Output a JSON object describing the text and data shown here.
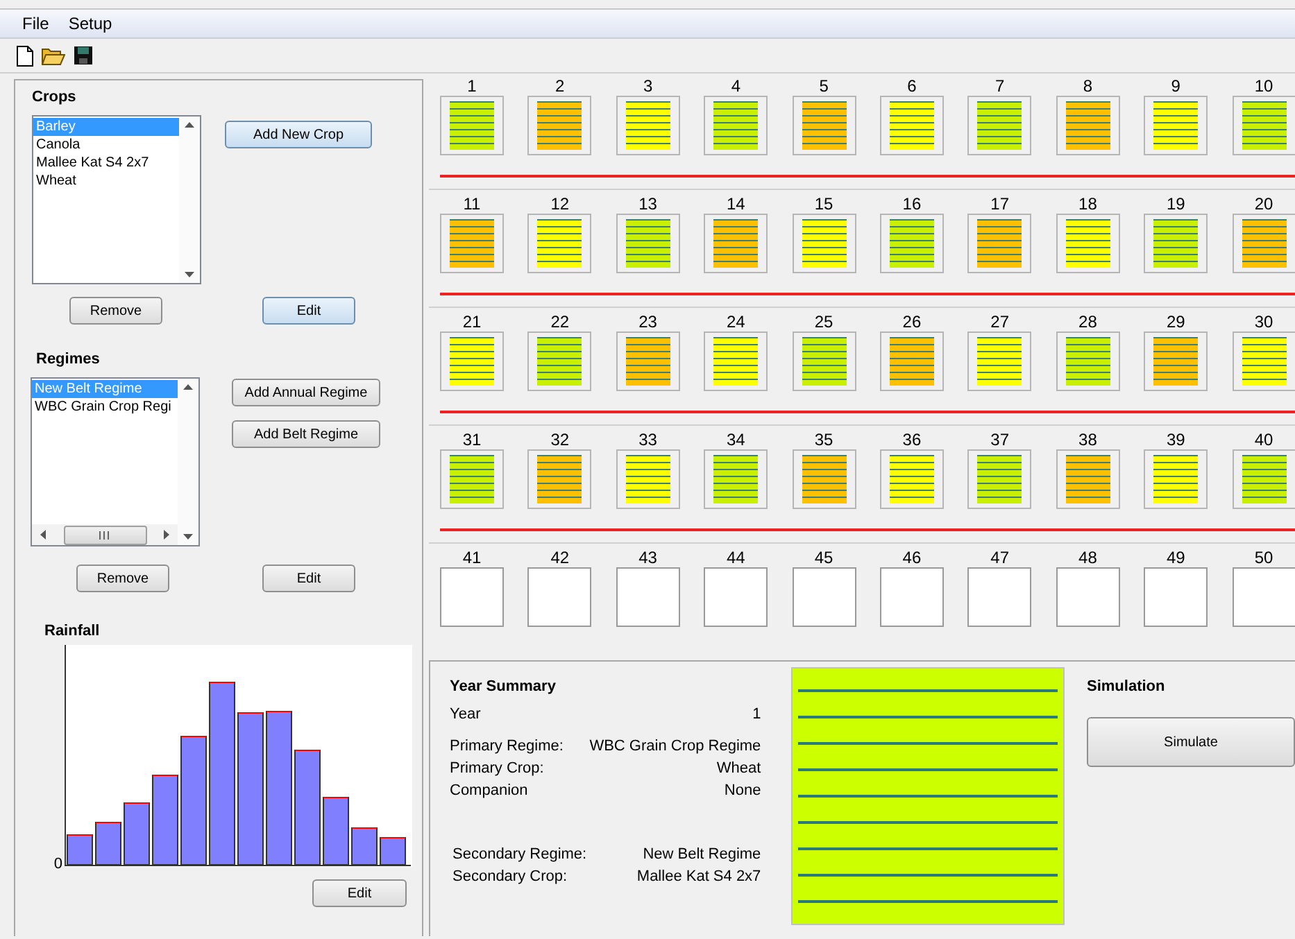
{
  "menu": [
    "File",
    "Setup"
  ],
  "crops": {
    "title": "Crops",
    "items": [
      {
        "label": "Barley",
        "selected": true
      },
      {
        "label": "Canola",
        "selected": false
      },
      {
        "label": "Mallee Kat S4 2x7",
        "selected": false
      },
      {
        "label": "Wheat",
        "selected": false
      }
    ],
    "add_button": "Add New Crop",
    "remove_button": "Remove",
    "edit_button": "Edit"
  },
  "regimes": {
    "title": "Regimes",
    "items": [
      {
        "label": "New Belt Regime",
        "selected": true
      },
      {
        "label": "WBC Grain Crop Regi",
        "selected": false
      }
    ],
    "add_buttons": [
      "Add Annual Regime",
      "Add Belt Regime"
    ],
    "remove_button": "Remove",
    "edit_button": "Edit"
  },
  "rainfall": {
    "title": "Rainfall",
    "axis_label": "0",
    "edit_button": "Edit"
  },
  "tiles": [
    {
      "number": "1",
      "kind": "planted",
      "color": "#c8f000"
    },
    {
      "number": "2",
      "kind": "planted",
      "color": "#ffc000"
    },
    {
      "number": "3",
      "kind": "planted",
      "color": "#ffff00"
    },
    {
      "number": "4",
      "kind": "planted",
      "color": "#c8f000"
    },
    {
      "number": "5",
      "kind": "planted",
      "color": "#ffc000"
    },
    {
      "number": "6",
      "kind": "planted",
      "color": "#ffff00"
    },
    {
      "number": "7",
      "kind": "planted",
      "color": "#c8f000"
    },
    {
      "number": "8",
      "kind": "planted",
      "color": "#ffc000"
    },
    {
      "number": "9",
      "kind": "planted",
      "color": "#ffff00"
    },
    {
      "number": "10",
      "kind": "planted",
      "color": "#c8f000"
    },
    {
      "number": "11",
      "kind": "planted",
      "color": "#ffc000"
    },
    {
      "number": "12",
      "kind": "planted",
      "color": "#ffff00"
    },
    {
      "number": "13",
      "kind": "planted",
      "color": "#c8f000"
    },
    {
      "number": "14",
      "kind": "planted",
      "color": "#ffc000"
    },
    {
      "number": "15",
      "kind": "planted",
      "color": "#ffff00"
    },
    {
      "number": "16",
      "kind": "planted",
      "color": "#c8f000"
    },
    {
      "number": "17",
      "kind": "planted",
      "color": "#ffc000"
    },
    {
      "number": "18",
      "kind": "planted",
      "color": "#ffff00"
    },
    {
      "number": "19",
      "kind": "planted",
      "color": "#c8f000"
    },
    {
      "number": "20",
      "kind": "planted",
      "color": "#ffc000"
    },
    {
      "number": "21",
      "kind": "planted",
      "color": "#ffff00"
    },
    {
      "number": "22",
      "kind": "planted",
      "color": "#c8f000"
    },
    {
      "number": "23",
      "kind": "planted",
      "color": "#ffc000"
    },
    {
      "number": "24",
      "kind": "planted",
      "color": "#ffff00"
    },
    {
      "number": "25",
      "kind": "planted",
      "color": "#c8f000"
    },
    {
      "number": "26",
      "kind": "planted",
      "color": "#ffc000"
    },
    {
      "number": "27",
      "kind": "planted",
      "color": "#ffff00"
    },
    {
      "number": "28",
      "kind": "planted",
      "color": "#c8f000"
    },
    {
      "number": "29",
      "kind": "planted",
      "color": "#ffc000"
    },
    {
      "number": "30",
      "kind": "planted",
      "color": "#ffff00"
    },
    {
      "number": "31",
      "kind": "planted",
      "color": "#c8f000"
    },
    {
      "number": "32",
      "kind": "planted",
      "color": "#ffc000"
    },
    {
      "number": "33",
      "kind": "planted",
      "color": "#ffff00"
    },
    {
      "number": "34",
      "kind": "planted",
      "color": "#c8f000"
    },
    {
      "number": "35",
      "kind": "planted",
      "color": "#ffc000"
    },
    {
      "number": "36",
      "kind": "planted",
      "color": "#ffff00"
    },
    {
      "number": "37",
      "kind": "planted",
      "color": "#c8f000"
    },
    {
      "number": "38",
      "kind": "planted",
      "color": "#ffc000"
    },
    {
      "number": "39",
      "kind": "planted",
      "color": "#ffff00"
    },
    {
      "number": "40",
      "kind": "planted",
      "color": "#c8f000"
    },
    {
      "number": "41",
      "kind": "empty"
    },
    {
      "number": "42",
      "kind": "empty"
    },
    {
      "number": "43",
      "kind": "empty"
    },
    {
      "number": "44",
      "kind": "empty"
    },
    {
      "number": "45",
      "kind": "empty"
    },
    {
      "number": "46",
      "kind": "empty"
    },
    {
      "number": "47",
      "kind": "empty"
    },
    {
      "number": "48",
      "kind": "empty"
    },
    {
      "number": "49",
      "kind": "empty"
    },
    {
      "number": "50",
      "kind": "empty"
    }
  ],
  "year_summary": {
    "title": "Year Summary",
    "primary": [
      {
        "label": "Year",
        "value": "1"
      },
      {
        "label": "Primary Regime:",
        "value": "WBC Grain Crop Regime"
      },
      {
        "label": "Primary Crop:",
        "value": "Wheat"
      },
      {
        "label": "Companion",
        "value": "None"
      }
    ],
    "secondary": [
      {
        "label": "Secondary Regime:",
        "value": "New Belt Regime"
      },
      {
        "label": "Secondary Crop:",
        "value": "Mallee Kat S4 2x7"
      }
    ]
  },
  "simulation": {
    "title": "Simulation",
    "button": "Simulate"
  }
}
